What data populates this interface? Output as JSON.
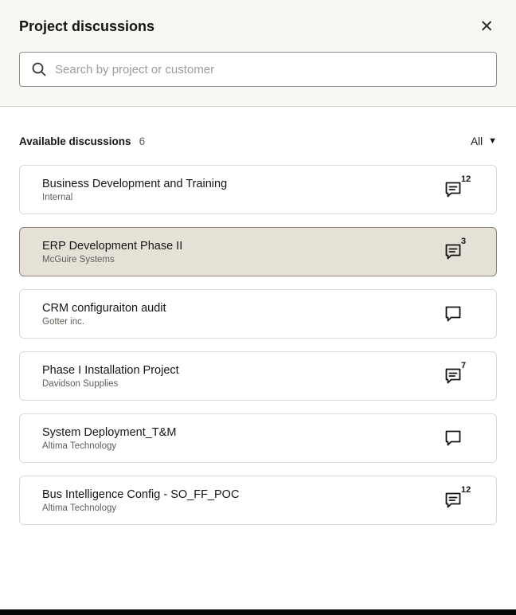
{
  "modal": {
    "title": "Project discussions"
  },
  "search": {
    "placeholder": "Search by project or customer"
  },
  "list_header": {
    "label": "Available discussions",
    "count": "6",
    "filter_label": "All"
  },
  "discussions": [
    {
      "title": "Business Development and Training",
      "customer": "Internal",
      "messages": "12",
      "selected": false
    },
    {
      "title": "ERP Development Phase II",
      "customer": "McGuire Systems",
      "messages": "3",
      "selected": true
    },
    {
      "title": "CRM configuraiton audit",
      "customer": "Gotter inc.",
      "messages": "",
      "selected": false
    },
    {
      "title": "Phase I Installation Project",
      "customer": "Davidson Supplies",
      "messages": "7",
      "selected": false
    },
    {
      "title": "System Deployment_T&M",
      "customer": "Altima Technology",
      "messages": "",
      "selected": false
    },
    {
      "title": "Bus Intelligence Config - SO_FF_POC",
      "customer": "Altima Technology",
      "messages": "12",
      "selected": false
    }
  ],
  "colors": {
    "selected_card_bg": "#e6e1d6",
    "selected_card_border": "#8b8577",
    "header_bg": "#f8f7f4",
    "text_primary": "#161513",
    "text_secondary": "#5f5e58"
  }
}
